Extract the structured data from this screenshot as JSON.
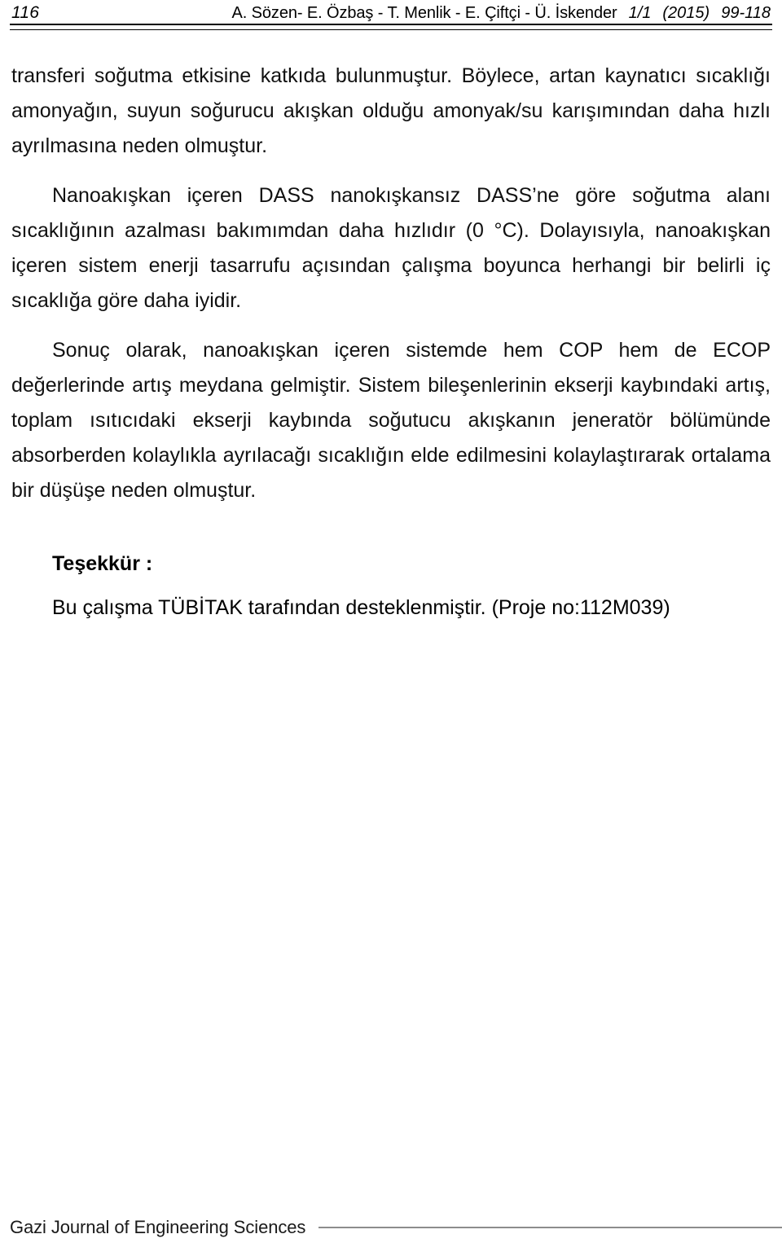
{
  "document": {
    "page_number": "116",
    "running_head": {
      "authors": "A. Sözen- E. Özbaş - T. Menlik - E. Çiftçi - Ü. İskender",
      "volume_issue": "1/1",
      "year": "(2015)",
      "pages": "99-118"
    },
    "body": {
      "paragraph_1": "transferi soğutma etkisine katkıda bulunmuştur. Böylece, artan kaynatıcı sıcaklığı amonyağın, suyun soğurucu akışkan olduğu amonyak/su karışımından daha hızlı ayrılmasına neden olmuştur.",
      "paragraph_2": "Nanoakışkan içeren DASS nanokışkansız DASS’ne göre soğutma alanı sıcaklığının azalması bakımımdan daha hızlıdır (0 °C). Dolayısıyla, nanoakışkan içeren sistem enerji tasarrufu açısından çalışma boyunca herhangi bir belirli iç sıcaklığa göre daha iyidir.",
      "paragraph_3": "Sonuç olarak, nanoakışkan içeren sistemde hem COP hem de ECOP değerlerinde artış meydana gelmiştir. Sistem bileşenlerinin ekserji kaybındaki artış, toplam ısıtıcıdaki ekserji kaybında soğutucu akışkanın jeneratör bölümünde absorberden kolaylıkla ayrılacağı sıcaklığın elde edilmesini kolaylaştırarak ortalama bir  düşüşe neden olmuştur."
    },
    "acknowledgement": {
      "heading": "Teşekkür :",
      "text": "Bu çalışma TÜBİTAK tarafından desteklenmiştir. (Proje no:112M039)"
    },
    "footer": {
      "journal_name": "Gazi Journal of Engineering Sciences"
    },
    "colors": {
      "text": "#111111",
      "rule": "#000000",
      "footer_rule": "#8c8c8c",
      "background": "#ffffff"
    }
  }
}
